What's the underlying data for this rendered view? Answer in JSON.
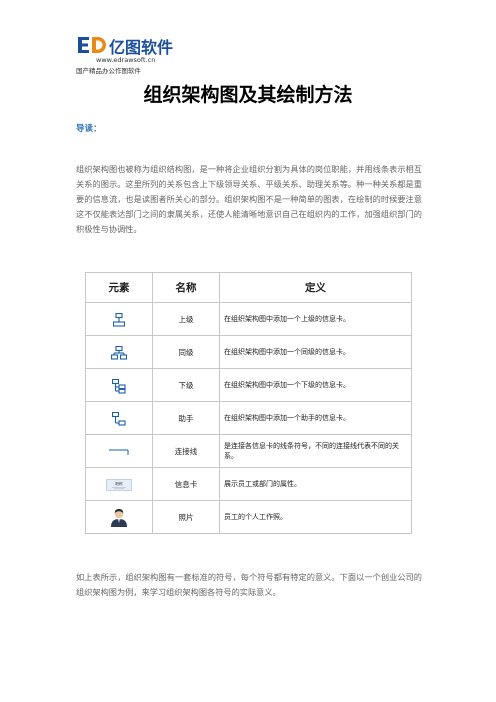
{
  "header": {
    "logo_text": "亿图软件",
    "logo_url": "www.edrawsoft.cn",
    "logo_tagline": "国产精品办公作图软件",
    "brand_color": "#1b4f9c",
    "brand_accent": "#e88a1a"
  },
  "document": {
    "title": "组织架构图及其绘制方法",
    "intro_label": "导读：",
    "paragraph_1": "组织架构图也被称为组织结构图，是一种将企业组织分割为具体的岗位职能，并用线条表示相互关系的图示。这里所列的关系包含上下级领导关系、平级关系、助理关系等。种一种关系都是重要的信息流，也是读图者所关心的部分。组织架构图不是一种简单的图表，在绘制的时候要注意这不仅能表达部门之间的隶属关系，还使人能清晰地意识自己在组织内的工作，加强组织部门的积极性与协调性。",
    "paragraph_2": "如上表所示，组织架构图有一套标准的符号，每个符号都有特定的意义。下面以一个创业公司的组织架构图为例，来学习组织架构图各符号的实际意义。"
  },
  "table": {
    "headers": [
      "元素",
      "名称",
      "定义"
    ],
    "rows": [
      {
        "icon": "superior-icon",
        "name": "上级",
        "definition": "在组织架构图中添加一个上级的信息卡。"
      },
      {
        "icon": "peer-icon",
        "name": "同级",
        "definition": "在组织架构图中添加一个同级的信息卡。"
      },
      {
        "icon": "subordinate-icon",
        "name": "下级",
        "definition": "在组织架构图中添加一个下级的信息卡。"
      },
      {
        "icon": "assistant-icon",
        "name": "助手",
        "definition": "在组织架构图中添加一个助手的信息卡。"
      },
      {
        "icon": "connector-icon",
        "name": "连接线",
        "definition": "是连接各信息卡的线条符号，不同的连接线代表不同的关系。"
      },
      {
        "icon": "info-card-icon",
        "name": "信息卡",
        "definition": "展示员工或部门的属性。"
      },
      {
        "icon": "photo-icon",
        "name": "照片",
        "definition": "员工的个人工作照。"
      }
    ],
    "info_card_icon_label": "职称"
  }
}
